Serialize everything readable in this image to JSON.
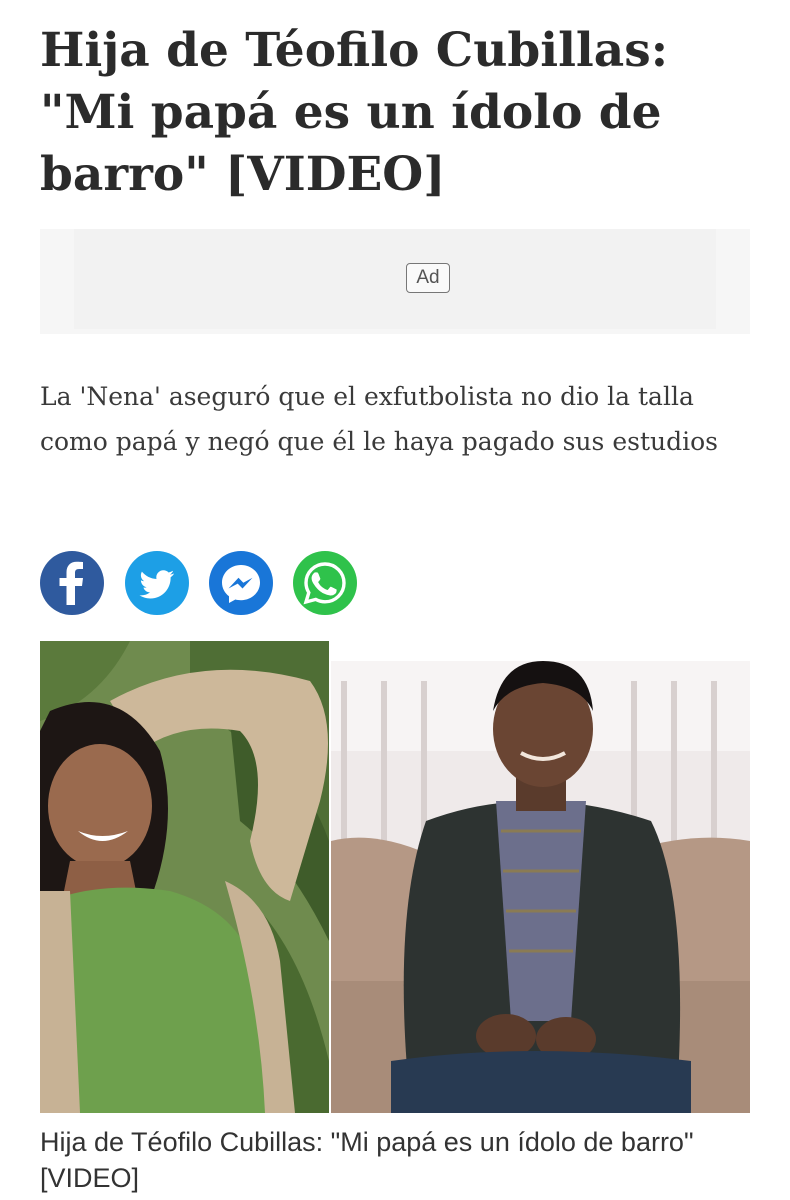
{
  "article": {
    "headline": "Hija de Téofilo Cubillas: \"Mi papá es un ídolo de barro\" [VIDEO]",
    "ad_label": "Ad",
    "summary": "La 'Nena' aseguró que el exfutbolista no dio la talla como papá y negó que él le haya pagado sus estudios",
    "image_caption": "Hija de Téofilo Cubillas: \"Mi papá es un ídolo de barro\" [VIDEO]"
  },
  "share": {
    "buttons": [
      {
        "network": "facebook",
        "icon": "facebook-icon",
        "color": "#2f5a9e"
      },
      {
        "network": "twitter",
        "icon": "twitter-icon",
        "color": "#1d9fe6"
      },
      {
        "network": "messenger",
        "icon": "messenger-icon",
        "color": "#1976d8"
      },
      {
        "network": "whatsapp",
        "icon": "whatsapp-icon",
        "color": "#2fc24b"
      }
    ]
  },
  "colors": {
    "headline": "#2b2b2b",
    "body_text": "#3a3a3a",
    "ad_background": "#f6f6f6"
  }
}
